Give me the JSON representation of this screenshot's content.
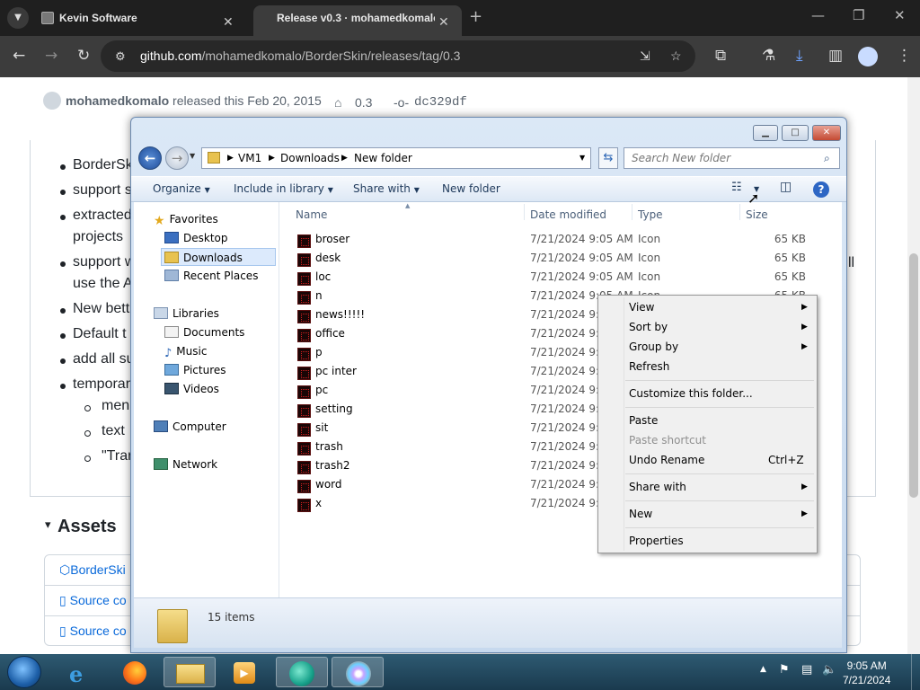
{
  "browser": {
    "tabs": [
      {
        "title": "Kevin Software"
      },
      {
        "title": "Release v0.3 · mohamedkomalo"
      }
    ],
    "url_host": "github.com",
    "url_path": "/mohamedkomalo/BorderSkin/releases/tag/0.3"
  },
  "release": {
    "author": "mohamedkomalo",
    "released_text": "released this Feb 20, 2015",
    "tag": "0.3",
    "commit": "dc329df",
    "notes": [
      {
        "text": "BorderSk",
        "level": 1
      },
      {
        "text": "support s",
        "level": 1
      },
      {
        "text": "extracted",
        "level": 1
      },
      {
        "text": "projects",
        "level": 0
      },
      {
        "text": "support w",
        "level": 1
      },
      {
        "text": "use the A",
        "level": 0
      },
      {
        "text": "New bett",
        "level": 1
      },
      {
        "text": "Default t",
        "level": 1
      },
      {
        "text": "add all su",
        "level": 1
      },
      {
        "text": "temporar",
        "level": 1
      },
      {
        "text": "men",
        "level": 2
      },
      {
        "text": "text",
        "level": 2
      },
      {
        "text": "\"Trar",
        "level": 2
      }
    ],
    "assets_heading": "Assets",
    "assets": [
      "BorderSki",
      "Source co",
      "Source co"
    ]
  },
  "explorer": {
    "breadcrumb": [
      "VM1",
      "Downloads",
      "New folder"
    ],
    "search_placeholder": "Search New folder",
    "commands": [
      "Organize",
      "Include in library",
      "Share with",
      "New folder"
    ],
    "nav": {
      "favorites": {
        "label": "Favorites",
        "items": [
          "Desktop",
          "Downloads",
          "Recent Places"
        ]
      },
      "libraries": {
        "label": "Libraries",
        "items": [
          "Documents",
          "Music",
          "Pictures",
          "Videos"
        ]
      },
      "computer": "Computer",
      "network": "Network"
    },
    "columns": {
      "name": "Name",
      "date": "Date modified",
      "type": "Type",
      "size": "Size"
    },
    "files": [
      {
        "name": "broser",
        "date": "7/21/2024 9:05 AM",
        "type": "Icon",
        "size": "65 KB"
      },
      {
        "name": "desk",
        "date": "7/21/2024 9:05 AM",
        "type": "Icon",
        "size": "65 KB"
      },
      {
        "name": "loc",
        "date": "7/21/2024 9:05 AM",
        "type": "Icon",
        "size": "65 KB"
      },
      {
        "name": "n",
        "date": "7/21/2024 9:05 AM",
        "type": "Icon",
        "size": "65 KB"
      },
      {
        "name": "news!!!!!",
        "date": "7/21/2024 9:05",
        "type": "",
        "size": ""
      },
      {
        "name": "office",
        "date": "7/21/2024 9:05",
        "type": "",
        "size": ""
      },
      {
        "name": "p",
        "date": "7/21/2024 9:05",
        "type": "",
        "size": ""
      },
      {
        "name": "pc inter",
        "date": "7/21/2024 9:05",
        "type": "",
        "size": ""
      },
      {
        "name": "pc",
        "date": "7/21/2024 9:05",
        "type": "",
        "size": ""
      },
      {
        "name": "setting",
        "date": "7/21/2024 9:05",
        "type": "",
        "size": ""
      },
      {
        "name": "sit",
        "date": "7/21/2024 9:05",
        "type": "",
        "size": ""
      },
      {
        "name": "trash",
        "date": "7/21/2024 9:05",
        "type": "",
        "size": ""
      },
      {
        "name": "trash2",
        "date": "7/21/2024 9:05",
        "type": "",
        "size": ""
      },
      {
        "name": "word",
        "date": "7/21/2024 9:05",
        "type": "",
        "size": ""
      },
      {
        "name": "x",
        "date": "7/21/2024 9:05",
        "type": "",
        "size": ""
      }
    ],
    "item_count": "15 items"
  },
  "context_menu": {
    "view": "View",
    "sort_by": "Sort by",
    "group_by": "Group by",
    "refresh": "Refresh",
    "customize": "Customize this folder...",
    "paste": "Paste",
    "paste_shortcut": "Paste shortcut",
    "undo_rename": "Undo Rename",
    "undo_shortcut": "Ctrl+Z",
    "share_with": "Share with",
    "new": "New",
    "properties": "Properties"
  },
  "taskbar": {
    "time": "9:05 AM",
    "date": "7/21/2024"
  }
}
